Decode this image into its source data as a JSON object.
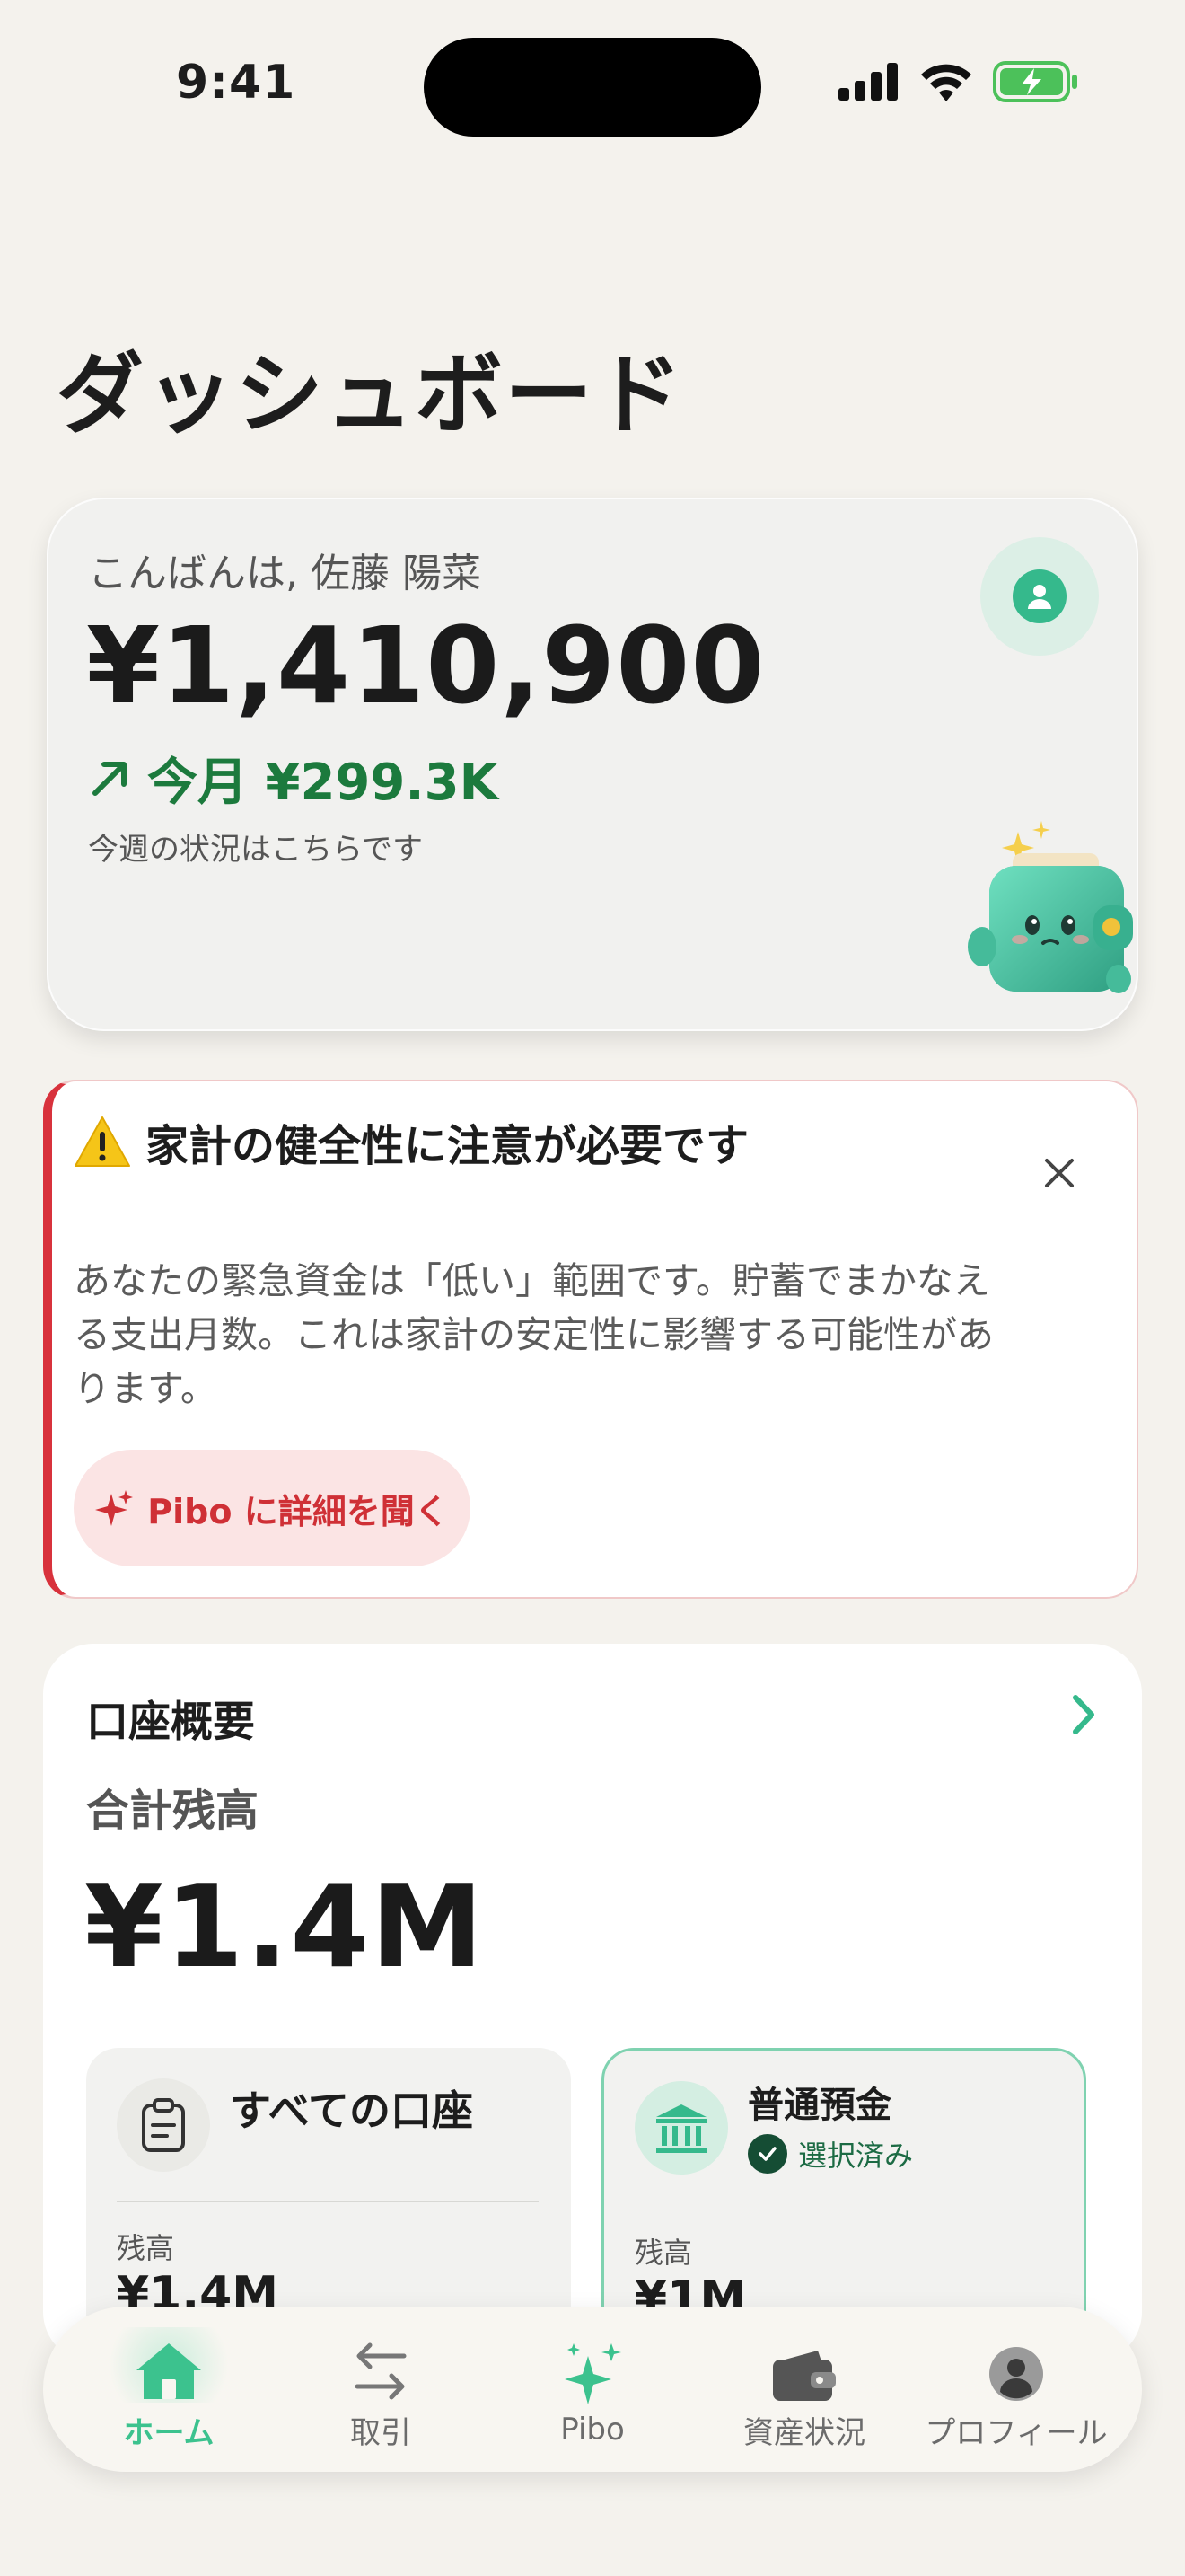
{
  "status_bar": {
    "time": "9:41"
  },
  "page": {
    "title": "ダッシュボード"
  },
  "hero": {
    "greeting": "こんばんは, 佐藤 陽菜",
    "balance": "¥1,410,900",
    "change": "今月 ¥299.3K",
    "subtitle": "今週の状況はこちらです",
    "avatar_icon": "user-icon",
    "accent_color": "#35b98c"
  },
  "alert": {
    "title": "家計の健全性に注意が必要です",
    "body": "あなたの緊急資金は「低い」範囲です。貯蓄でまかなえる支出月数。これは家計の安定性に影響する可能性があります。",
    "button_label": "Pibo に詳細を聞く",
    "accent_color": "#d8323c"
  },
  "accounts": {
    "heading": "口座概要",
    "total_label": "合計残高",
    "total_value": "¥1.4M",
    "tiles": [
      {
        "name": "すべての口座",
        "balance_label": "残高",
        "balance": "¥1.4M",
        "icon": "clipboard-icon"
      },
      {
        "name": "普通預金",
        "selected_label": "選択済み",
        "balance_label": "残高",
        "balance": "¥1M",
        "icon": "bank-icon"
      }
    ]
  },
  "nav": {
    "items": [
      {
        "label": "ホーム",
        "icon": "home-icon",
        "active": true
      },
      {
        "label": "取引",
        "icon": "transfer-icon"
      },
      {
        "label": "Pibo",
        "icon": "sparkle-icon"
      },
      {
        "label": "資産状況",
        "icon": "wallet-icon"
      },
      {
        "label": "プロフィール",
        "icon": "profile-icon"
      }
    ],
    "active_color": "#3cc28e"
  }
}
